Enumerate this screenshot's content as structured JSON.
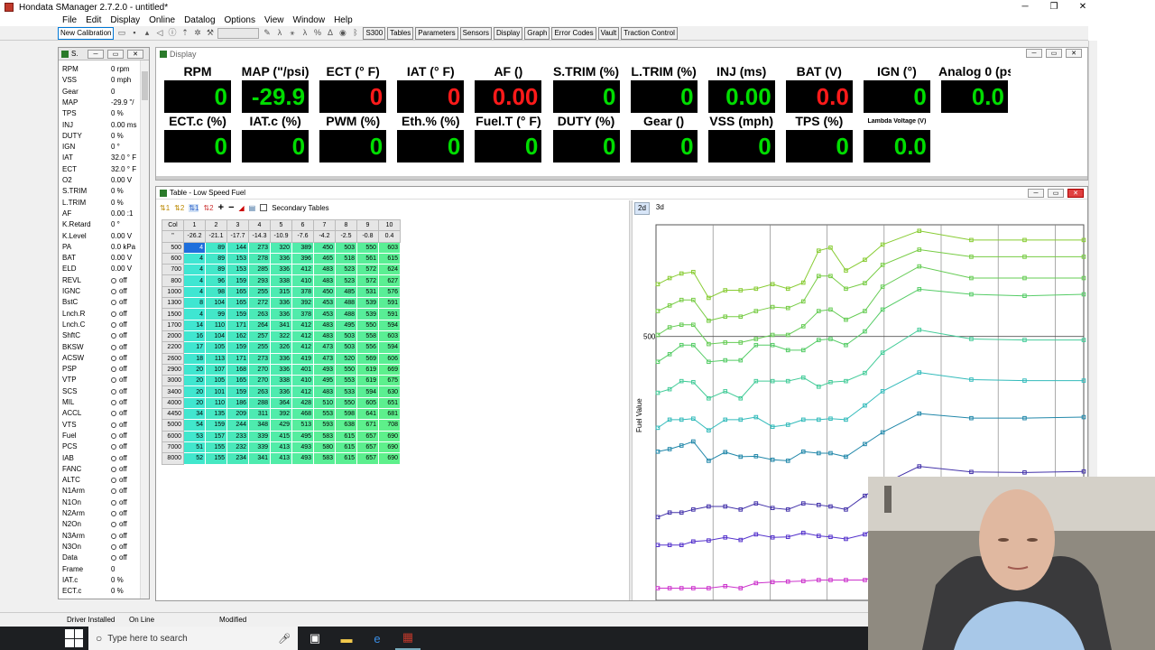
{
  "app": {
    "title": "Hondata SManager 2.7.2.0 - untitled*",
    "window_controls": [
      "─",
      "❐",
      "✕"
    ]
  },
  "menu": [
    "File",
    "Edit",
    "Display",
    "Online",
    "Datalog",
    "Options",
    "View",
    "Window",
    "Help"
  ],
  "toolbar": {
    "new_calibration": "New Calibration",
    "buttons": [
      "S300",
      "Tables",
      "Parameters",
      "Sensors",
      "Display",
      "Graph",
      "Error Codes",
      "Vault",
      "Traction Control"
    ]
  },
  "sensors_panel": {
    "title": "S.",
    "rows": [
      {
        "k": "RPM",
        "v": "0 rpm"
      },
      {
        "k": "VSS",
        "v": "0 mph"
      },
      {
        "k": "Gear",
        "v": "0"
      },
      {
        "k": "MAP",
        "v": "-29.9 \"/"
      },
      {
        "k": "TPS",
        "v": "0 %"
      },
      {
        "k": "INJ",
        "v": "0.00 ms"
      },
      {
        "k": "DUTY",
        "v": "0 %"
      },
      {
        "k": "IGN",
        "v": "0 °"
      },
      {
        "k": "IAT",
        "v": "32.0 ° F"
      },
      {
        "k": "ECT",
        "v": "32.0 ° F"
      },
      {
        "k": "O2",
        "v": "0.00 V"
      },
      {
        "k": "S.TRIM",
        "v": "0 %"
      },
      {
        "k": "L.TRIM",
        "v": "0 %"
      },
      {
        "k": "AF",
        "v": "0.00 :1"
      },
      {
        "k": "K.Retard",
        "v": "0 °"
      },
      {
        "k": "K.Level",
        "v": "0.00 V"
      },
      {
        "k": "PA",
        "v": "0.0 kPa"
      },
      {
        "k": "BAT",
        "v": "0.00 V"
      },
      {
        "k": "ELD",
        "v": "0.00 V"
      },
      {
        "k": "REVL",
        "v": "off",
        "dot": true
      },
      {
        "k": "IGNC",
        "v": "off",
        "dot": true
      },
      {
        "k": "BstC",
        "v": "off",
        "dot": true
      },
      {
        "k": "Lnch.R",
        "v": "off",
        "dot": true
      },
      {
        "k": "Lnch.C",
        "v": "off",
        "dot": true
      },
      {
        "k": "ShftC",
        "v": "off",
        "dot": true
      },
      {
        "k": "BKSW",
        "v": "off",
        "dot": true
      },
      {
        "k": "ACSW",
        "v": "off",
        "dot": true
      },
      {
        "k": "PSP",
        "v": "off",
        "dot": true
      },
      {
        "k": "VTP",
        "v": "off",
        "dot": true
      },
      {
        "k": "SCS",
        "v": "off",
        "dot": true
      },
      {
        "k": "MIL",
        "v": "off",
        "dot": true
      },
      {
        "k": "ACCL",
        "v": "off",
        "dot": true
      },
      {
        "k": "VTS",
        "v": "off",
        "dot": true
      },
      {
        "k": "Fuel",
        "v": "off",
        "dot": true
      },
      {
        "k": "PCS",
        "v": "off",
        "dot": true
      },
      {
        "k": "IAB",
        "v": "off",
        "dot": true
      },
      {
        "k": "FANC",
        "v": "off",
        "dot": true
      },
      {
        "k": "ALTC",
        "v": "off",
        "dot": true
      },
      {
        "k": "N1Arm",
        "v": "off",
        "dot": true
      },
      {
        "k": "N1On",
        "v": "off",
        "dot": true
      },
      {
        "k": "N2Arm",
        "v": "off",
        "dot": true
      },
      {
        "k": "N2On",
        "v": "off",
        "dot": true
      },
      {
        "k": "N3Arm",
        "v": "off",
        "dot": true
      },
      {
        "k": "N3On",
        "v": "off",
        "dot": true
      },
      {
        "k": "Data",
        "v": "off",
        "dot": true
      },
      {
        "k": "Frame",
        "v": "0"
      },
      {
        "k": "IAT.c",
        "v": "0 %"
      },
      {
        "k": "ECT.c",
        "v": "0 %"
      }
    ]
  },
  "display_window": {
    "title": "Display",
    "gauges_row1": [
      {
        "label": "RPM",
        "value": "0",
        "color": "green"
      },
      {
        "label": "MAP (\"/psi)",
        "value": "-29.9",
        "color": "green"
      },
      {
        "label": "ECT (° F)",
        "value": "0",
        "color": "red"
      },
      {
        "label": "IAT (° F)",
        "value": "0",
        "color": "red"
      },
      {
        "label": "AF ()",
        "value": "0.00",
        "color": "red"
      },
      {
        "label": "S.TRIM (%)",
        "value": "0",
        "color": "green"
      },
      {
        "label": "L.TRIM (%)",
        "value": "0",
        "color": "green"
      },
      {
        "label": "INJ (ms)",
        "value": "0.00",
        "color": "green"
      },
      {
        "label": "BAT (V)",
        "value": "0.0",
        "color": "red"
      },
      {
        "label": "IGN (°)",
        "value": "0",
        "color": "green"
      },
      {
        "label": "Analog 0 (psi)",
        "value": "0.0",
        "color": "green"
      }
    ],
    "gauges_row2": [
      {
        "label": "ECT.c (%)",
        "value": "0",
        "color": "green"
      },
      {
        "label": "IAT.c (%)",
        "value": "0",
        "color": "green"
      },
      {
        "label": "PWM (%)",
        "value": "0",
        "color": "green"
      },
      {
        "label": "Eth.% (%)",
        "value": "0",
        "color": "green"
      },
      {
        "label": "Fuel.T (° F)",
        "value": "0",
        "color": "green"
      },
      {
        "label": "DUTY (%)",
        "value": "0",
        "color": "green"
      },
      {
        "label": "Gear ()",
        "value": "0",
        "color": "green"
      },
      {
        "label": "VSS (mph)",
        "value": "0",
        "color": "green"
      },
      {
        "label": "TPS (%)",
        "value": "0",
        "color": "green"
      },
      {
        "label": "Lambda Voltage (V)",
        "value": "0.0",
        "color": "green",
        "small": true
      }
    ]
  },
  "table_window": {
    "title": "Table - Low Speed Fuel",
    "secondary_tables": "Secondary Tables",
    "col_header": "Col",
    "col_numbers": [
      "1",
      "2",
      "3",
      "4",
      "5",
      "6",
      "7",
      "8",
      "9",
      "10"
    ],
    "map_header": "\"",
    "map_values": [
      "-26.2",
      "-21.1",
      "-17.7",
      "-14.3",
      "-10.9",
      "-7.6",
      "-4.2",
      "-2.5",
      "-0.8",
      "0.4"
    ],
    "rows": [
      {
        "rpm": "500",
        "v": [
          "4",
          "89",
          "144",
          "273",
          "320",
          "389",
          "450",
          "503",
          "550",
          "603"
        ]
      },
      {
        "rpm": "600",
        "v": [
          "4",
          "89",
          "153",
          "278",
          "336",
          "396",
          "465",
          "518",
          "561",
          "615"
        ]
      },
      {
        "rpm": "700",
        "v": [
          "4",
          "89",
          "153",
          "285",
          "336",
          "412",
          "483",
          "523",
          "572",
          "624"
        ]
      },
      {
        "rpm": "800",
        "v": [
          "4",
          "96",
          "159",
          "293",
          "338",
          "410",
          "483",
          "523",
          "572",
          "627"
        ]
      },
      {
        "rpm": "1000",
        "v": [
          "4",
          "98",
          "165",
          "255",
          "315",
          "378",
          "450",
          "485",
          "531",
          "576"
        ]
      },
      {
        "rpm": "1300",
        "v": [
          "8",
          "104",
          "165",
          "272",
          "336",
          "392",
          "453",
          "488",
          "539",
          "591"
        ]
      },
      {
        "rpm": "1500",
        "v": [
          "4",
          "99",
          "159",
          "263",
          "336",
          "378",
          "453",
          "488",
          "539",
          "591"
        ]
      },
      {
        "rpm": "1700",
        "v": [
          "14",
          "110",
          "171",
          "264",
          "341",
          "412",
          "483",
          "495",
          "550",
          "594"
        ]
      },
      {
        "rpm": "2000",
        "v": [
          "16",
          "104",
          "162",
          "257",
          "322",
          "412",
          "483",
          "503",
          "558",
          "603"
        ]
      },
      {
        "rpm": "2200",
        "v": [
          "17",
          "105",
          "159",
          "255",
          "326",
          "412",
          "473",
          "503",
          "556",
          "594"
        ]
      },
      {
        "rpm": "2600",
        "v": [
          "18",
          "113",
          "171",
          "273",
          "336",
          "419",
          "473",
          "520",
          "569",
          "606"
        ]
      },
      {
        "rpm": "2900",
        "v": [
          "20",
          "107",
          "168",
          "270",
          "336",
          "401",
          "493",
          "550",
          "619",
          "669"
        ]
      },
      {
        "rpm": "3000",
        "v": [
          "20",
          "105",
          "165",
          "270",
          "338",
          "410",
          "495",
          "553",
          "619",
          "675"
        ]
      },
      {
        "rpm": "3400",
        "v": [
          "20",
          "101",
          "159",
          "263",
          "336",
          "412",
          "483",
          "533",
          "594",
          "630"
        ]
      },
      {
        "rpm": "4000",
        "v": [
          "20",
          "110",
          "186",
          "288",
          "364",
          "428",
          "510",
          "550",
          "605",
          "651"
        ]
      },
      {
        "rpm": "4450",
        "v": [
          "34",
          "135",
          "209",
          "311",
          "392",
          "468",
          "553",
          "598",
          "641",
          "681"
        ]
      },
      {
        "rpm": "5000",
        "v": [
          "54",
          "159",
          "244",
          "348",
          "429",
          "513",
          "593",
          "638",
          "671",
          "708"
        ]
      },
      {
        "rpm": "6000",
        "v": [
          "53",
          "157",
          "233",
          "339",
          "415",
          "495",
          "583",
          "615",
          "657",
          "690"
        ]
      },
      {
        "rpm": "7000",
        "v": [
          "51",
          "155",
          "232",
          "339",
          "413",
          "493",
          "580",
          "615",
          "657",
          "690"
        ]
      },
      {
        "rpm": "8000",
        "v": [
          "52",
          "155",
          "234",
          "341",
          "413",
          "493",
          "583",
          "615",
          "657",
          "690"
        ]
      }
    ],
    "graph_tabs": [
      "2d",
      "3d"
    ],
    "graph_ylabel": "Fuel Value",
    "graph_tick": "500"
  },
  "statusbar": {
    "driver": "Driver Installed",
    "online": "On Line",
    "modified": "Modified"
  },
  "taskbar": {
    "search_placeholder": "Type here to search"
  },
  "colors": {
    "cell_low": "#3fe6d2",
    "cell_high": "#5ef08a",
    "gauge_green": "#00dd00",
    "gauge_red": "#ff1a1a",
    "selection": "#1e6fdc"
  }
}
